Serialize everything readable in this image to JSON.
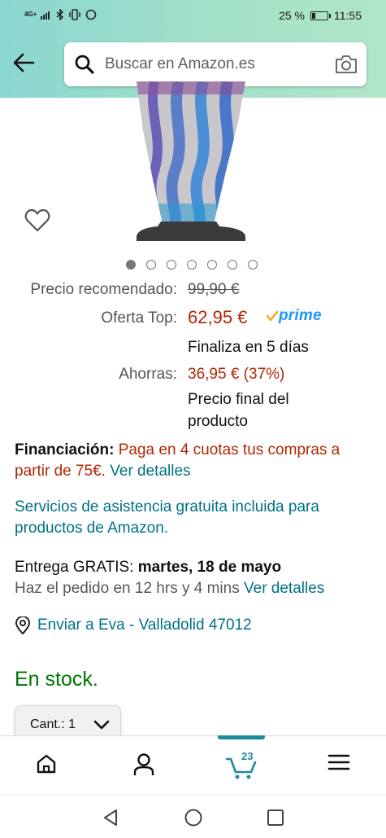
{
  "status_bar": {
    "network": "4G+",
    "battery": "25 %",
    "battery_level": 0.25,
    "time": "11:55"
  },
  "search": {
    "placeholder": "Buscar en Amazon.es"
  },
  "product": {
    "image_dots_total": 7,
    "image_dots_active_index": 0
  },
  "price": {
    "recommended_label": "Precio recomendado:",
    "recommended_value": "99,90 €",
    "deal_label": "Oferta Top:",
    "deal_value": "62,95 €",
    "prime_label": "prime",
    "deal_ends": "Finaliza en 5 días",
    "savings_label": "Ahorras:",
    "savings_value": "36,95 € (37%)",
    "final_price_line1": "Precio final del",
    "final_price_line2": "producto"
  },
  "financing": {
    "label": "Financiación:",
    "text_line1": "Paga en 4 cuotas tus compras a",
    "text_line2": "partir de 75€.",
    "link": "Ver detalles"
  },
  "services": {
    "line1": "Servicios de asistencia gratuita incluida para",
    "line2": "productos de Amazon."
  },
  "delivery": {
    "prefix": "Entrega GRATIS:",
    "date": "martes, 18 de mayo",
    "order_within": "Haz el pedido en 12 hrs y 4 mins",
    "link": "Ver detalles"
  },
  "address": {
    "text": "Enviar a Eva - Valladolid 47012"
  },
  "stock": {
    "text": "En stock."
  },
  "quantity": {
    "label": "Cant.:",
    "value": "1"
  },
  "bottom_nav": {
    "cart_count": "23",
    "items": [
      "home-icon",
      "account-icon",
      "cart-icon",
      "menu-icon"
    ]
  },
  "colors": {
    "price_red": "#b12704",
    "link_teal": "#007185",
    "stock_green": "#007600",
    "prime_blue": "#1a98ff",
    "header_gradient_start": "#8ad6d0",
    "header_gradient_end": "#b0e6c8"
  }
}
